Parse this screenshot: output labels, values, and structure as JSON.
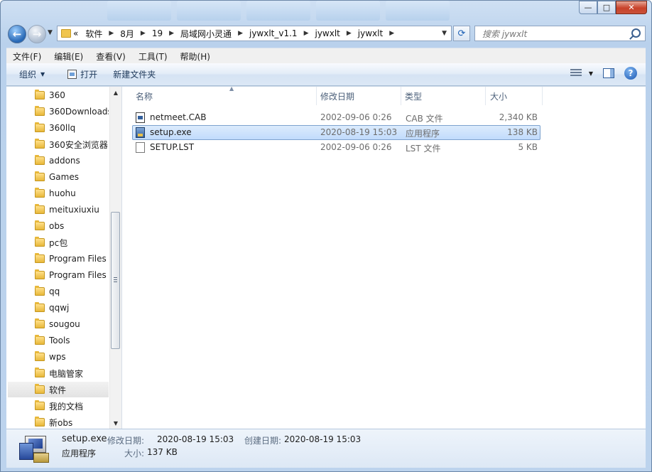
{
  "window": {
    "caption": {
      "minimize": "—",
      "maximize": "□",
      "close": "✕"
    }
  },
  "address": {
    "overflow": "«",
    "crumbs": [
      "软件",
      "8月",
      "19",
      "局域网小灵通",
      "jywxlt_v1.1",
      "jywxlt",
      "jywxlt"
    ]
  },
  "search": {
    "placeholder": "搜索 jywxlt"
  },
  "menu": [
    "文件(F)",
    "编辑(E)",
    "查看(V)",
    "工具(T)",
    "帮助(H)"
  ],
  "toolbar": {
    "organize": "组织",
    "open": "打开",
    "new_folder": "新建文件夹"
  },
  "nav_tree": [
    "360",
    "360Downloads",
    "360llq",
    "360安全浏览器",
    "addons",
    "Games",
    "huohu",
    "meituxiuxiu",
    "obs",
    "pc包",
    "Program Files",
    "Program Files",
    "qq",
    "qqwj",
    "sougou",
    "Tools",
    "wps",
    "电脑管家",
    "软件",
    "我的文档",
    "新obs"
  ],
  "nav_selected": "软件",
  "columns": {
    "name": "名称",
    "modified": "修改日期",
    "type": "类型",
    "size": "大小"
  },
  "files": [
    {
      "name": "netmeet.CAB",
      "modified": "2002-09-06 0:26",
      "type": "CAB 文件",
      "size": "2,340 KB",
      "icon": "cab-file-icon"
    },
    {
      "name": "setup.exe",
      "modified": "2020-08-19 15:03",
      "type": "应用程序",
      "size": "138 KB",
      "icon": "exe-file-icon",
      "selected": true
    },
    {
      "name": "SETUP.LST",
      "modified": "2002-09-06 0:26",
      "type": "LST 文件",
      "size": "5 KB",
      "icon": "text-file-icon"
    }
  ],
  "details": {
    "name": "setup.exe",
    "type": "应用程序",
    "modified_label": "修改日期:",
    "modified": "2020-08-19 15:03",
    "created_label": "创建日期:",
    "created": "2020-08-19 15:03",
    "size_label": "大小:",
    "size": "137 KB"
  }
}
